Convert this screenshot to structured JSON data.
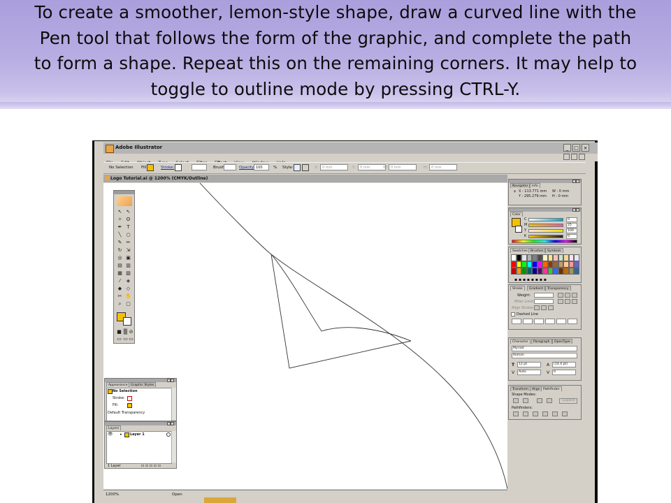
{
  "caption": {
    "line1": "To create a smoother, lemon-style shape, draw a curved line with the",
    "line2": "Pen tool that follows the form of the graphic, and complete the path",
    "line3": "to form a shape. Repeat this on the remaining corners. It may help to",
    "line4": "toggle to outline mode by pressing CTRL-Y."
  },
  "app": {
    "title": "Adobe Illustrator",
    "window_buttons": [
      "_",
      "□",
      "×"
    ],
    "menus": [
      "File",
      "Edit",
      "Object",
      "Type",
      "Select",
      "Filter",
      "Effect",
      "View",
      "Window",
      "Help"
    ]
  },
  "control_bar": {
    "selection": "No Selection",
    "fill_label": "Fill:",
    "stroke_label": "Stroke:",
    "brush_label": "Brush:",
    "opacity_label": "Opacity:",
    "opacity_value": "100",
    "percent": "%",
    "style_label": "Style:",
    "x_label": "X:",
    "x_value": "0 mm",
    "y_label": "Y:",
    "y_value": "0 mm",
    "w_label": "W:",
    "w_value": "0 mm",
    "h_label": "H:",
    "h_value": "0 mm",
    "fill_color": "#f6c000"
  },
  "document": {
    "tab_title": "Logo Tutorial.ai @ 1200% (CMYK/Outline)",
    "zoom": "1200%",
    "status": "Open"
  },
  "panels": {
    "info": {
      "tabs": [
        "Navigator",
        "Info"
      ],
      "x": "X : 113.771 mm",
      "y": "Y : 295.279 mm",
      "w": "W : 0 mm",
      "h": "H : 0 mm"
    },
    "color": {
      "title": "Color",
      "channels": [
        {
          "name": "C",
          "value": "0",
          "color": "#0aa0d0"
        },
        {
          "name": "M",
          "value": "25",
          "color": "#d0209a"
        },
        {
          "name": "Y",
          "value": "100",
          "color": "#f4e000"
        },
        {
          "name": "K",
          "value": "0",
          "color": "#222222"
        }
      ],
      "fill_color": "#f6c000"
    },
    "swatches": {
      "tabs": [
        "Swatches",
        "Brushes",
        "Symbols"
      ],
      "colors": [
        "#ffffff",
        "#000000",
        "#e6e6e6",
        "#b3b3b3",
        "#808080",
        "#4d4d4d",
        "#fff2cc",
        "#ffe680",
        "#f4c2c2",
        "#c8e6c9",
        "#ffd699",
        "#fce4ec",
        "#e6e6fa",
        "#ff0000",
        "#ffff00",
        "#00ff00",
        "#00ffff",
        "#0000ff",
        "#ff00ff",
        "#ff6600",
        "#993300",
        "#996633",
        "#cc9966",
        "#ffcc99",
        "#ff9999",
        "#6666cc",
        "#cc0000",
        "#ff9900",
        "#009900",
        "#006666",
        "#000099",
        "#660066",
        "#ff3399",
        "#33cc33",
        "#3366ff",
        "#663300",
        "#cc6600",
        "#999966",
        "#336699"
      ]
    },
    "stroke": {
      "tabs": [
        "Stroke",
        "Gradient",
        "Transparency"
      ],
      "weight_label": "Weight:",
      "miter_label": "Miter Limit:",
      "align_label": "Align Stroke:",
      "dashed": "Dashed Line"
    },
    "character": {
      "tabs": [
        "Character",
        "Paragraph",
        "OpenType"
      ],
      "font": "Myriad",
      "style": "Roman",
      "size": "12 pt",
      "leading": "(14.4 pt)",
      "kerning": "Auto",
      "tracking": "0"
    },
    "pathfinder": {
      "tabs": [
        "Transform",
        "Align",
        "Pathfinder"
      ],
      "shape_modes": "Shape Modes:",
      "expand": "Expand",
      "pathfinders": "Pathfinders:"
    },
    "appearance": {
      "tabs": [
        "Appearance",
        "Graphic Styles"
      ],
      "rows": [
        "No Selection",
        "Stroke:",
        "Fill:",
        "Default Transparency"
      ]
    },
    "layers": {
      "tab": "Layers",
      "layer": "Layer 1",
      "footer": "1 Layer"
    }
  }
}
